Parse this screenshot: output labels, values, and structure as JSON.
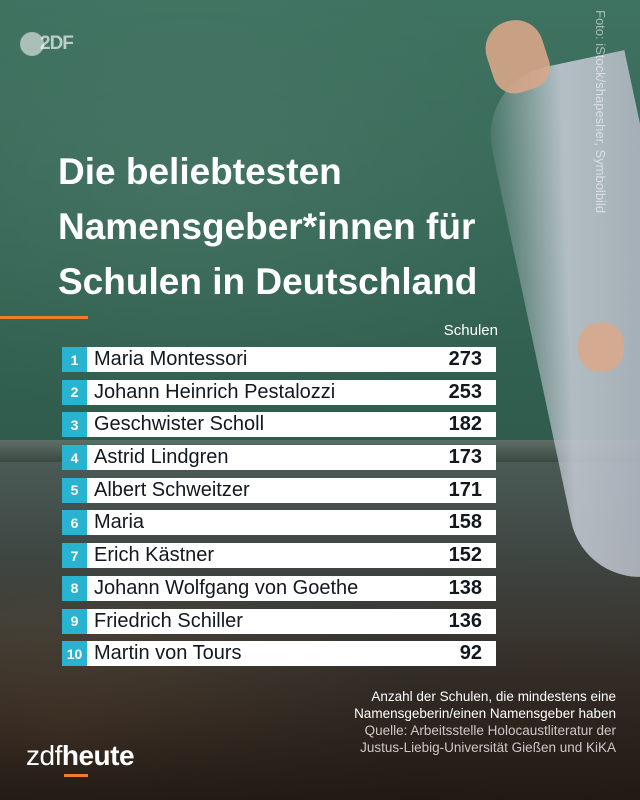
{
  "branding": {
    "logo_text": "2DF",
    "brand_prefix": "zdf",
    "brand_suffix": "heute"
  },
  "photo_credit": "Foto: iStock/shapesher, Symbolbild",
  "chart_data": {
    "type": "table",
    "title": "Die beliebtesten Namensgeber*innen für Schulen in Deutschland",
    "value_header": "Schulen",
    "rows": [
      {
        "rank": "1",
        "name": "Maria Montessori",
        "value": "273"
      },
      {
        "rank": "2",
        "name": "Johann Heinrich Pestalozzi",
        "value": "253"
      },
      {
        "rank": "3",
        "name": "Geschwister Scholl",
        "value": "182"
      },
      {
        "rank": "4",
        "name": "Astrid Lindgren",
        "value": "173"
      },
      {
        "rank": "5",
        "name": "Albert Schweitzer",
        "value": "171"
      },
      {
        "rank": "6",
        "name": "Maria",
        "value": "158"
      },
      {
        "rank": "7",
        "name": "Erich Kästner",
        "value": "152"
      },
      {
        "rank": "8",
        "name": "Johann Wolfgang von Goethe",
        "value": "138"
      },
      {
        "rank": "9",
        "name": "Friedrich Schiller",
        "value": "136"
      },
      {
        "rank": "10",
        "name": "Martin von Tours",
        "value": "92"
      }
    ]
  },
  "footnote": {
    "line1": "Anzahl der Schulen, die mindestens eine",
    "line2": "Namensgeberin/einen Namensgeber haben",
    "source1": "Quelle: Arbeitsstelle Holocaustliteratur der",
    "source2": "Justus-Liebig-Universität Gießen und KiKA"
  },
  "colors": {
    "accent": "#ef7d2d",
    "rank_badge": "#28b4d0",
    "row_bg": "#ffffff",
    "text_dark": "#111820"
  }
}
